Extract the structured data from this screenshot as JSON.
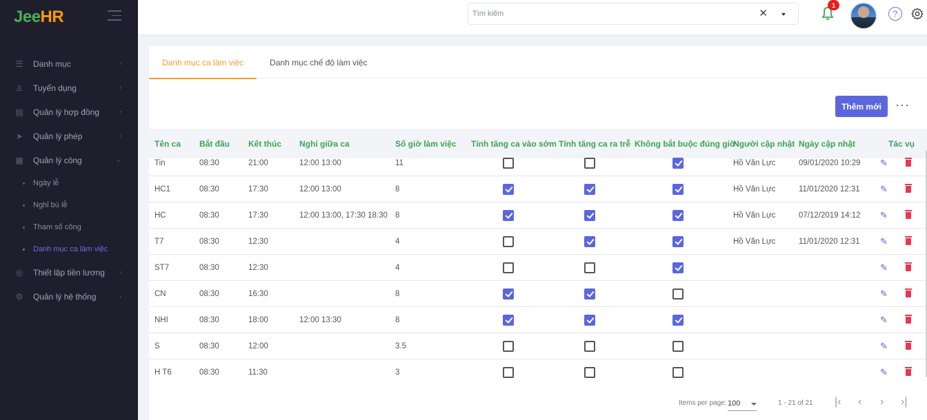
{
  "brand": {
    "part1": "Jee",
    "part2": "HR"
  },
  "sidebar": {
    "items": [
      {
        "label": "Danh mục",
        "icon": "list-icon"
      },
      {
        "label": "Tuyển dụng",
        "icon": "person-icon"
      },
      {
        "label": "Quản lý hợp đồng",
        "icon": "briefcase-icon"
      },
      {
        "label": "Quản lý phép",
        "icon": "send-icon"
      },
      {
        "label": "Quản lý công",
        "icon": "calendar-icon"
      }
    ],
    "sub_items": [
      {
        "label": "Ngày lễ",
        "active": false
      },
      {
        "label": "Nghỉ bù lễ",
        "active": false
      },
      {
        "label": "Tham số công",
        "active": false
      },
      {
        "label": "Danh mục ca làm việc",
        "active": true
      }
    ],
    "items_after": [
      {
        "label": "Thiết lập tiền lương",
        "icon": "settings-icon"
      },
      {
        "label": "Quản lý hệ thống",
        "icon": "cog-icon"
      }
    ]
  },
  "header": {
    "search_placeholder": "Tìm kiếm",
    "notification_count": "1"
  },
  "tabs": [
    {
      "label": "Danh mục ca làm việc",
      "active": true
    },
    {
      "label": "Danh mục chế độ làm việc",
      "active": false
    }
  ],
  "toolbar": {
    "add_label": "Thêm mới",
    "more_label": "···"
  },
  "table": {
    "headers": [
      "Tên ca",
      "Bắt đầu",
      "Kết thúc",
      "Nghỉ giữa ca",
      "Số giờ làm việc",
      "Tính tăng ca vào sớm",
      "Tính tăng ca ra trễ",
      "Không bắt buộc đúng giờ",
      "Người cập nhật",
      "Ngày cập nhật",
      "Tác vụ"
    ],
    "rows": [
      {
        "name": "Tin",
        "start": "08:30",
        "end": "21:00",
        "break": "12:00 13:00",
        "hours": "11",
        "early": false,
        "late": false,
        "flex": true,
        "updater": "Hồ Văn Lực",
        "updated": "09/01/2020 10:29"
      },
      {
        "name": "HC1",
        "start": "08:30",
        "end": "17:30",
        "break": "12:00 13:00",
        "hours": "8",
        "early": true,
        "late": true,
        "flex": true,
        "updater": "Hồ Văn Lực",
        "updated": "11/01/2020 12:31"
      },
      {
        "name": "HC",
        "start": "08:30",
        "end": "17:30",
        "break": "12:00 13:00, 17:30 18:30",
        "hours": "8",
        "early": true,
        "late": true,
        "flex": true,
        "updater": "Hồ Văn Lực",
        "updated": "07/12/2019 14:12"
      },
      {
        "name": "T7",
        "start": "08:30",
        "end": "12:30",
        "break": "",
        "hours": "4",
        "early": false,
        "late": true,
        "flex": true,
        "updater": "Hồ Văn Lực",
        "updated": "11/01/2020 12:31"
      },
      {
        "name": "ST7",
        "start": "08:30",
        "end": "12:30",
        "break": "",
        "hours": "4",
        "early": false,
        "late": false,
        "flex": true,
        "updater": "",
        "updated": ""
      },
      {
        "name": "CN",
        "start": "08:30",
        "end": "16:30",
        "break": "",
        "hours": "8",
        "early": true,
        "late": true,
        "flex": false,
        "updater": "",
        "updated": ""
      },
      {
        "name": "NHI",
        "start": "08:30",
        "end": "18:00",
        "break": "12:00 13:30",
        "hours": "8",
        "early": true,
        "late": true,
        "flex": true,
        "updater": "",
        "updated": ""
      },
      {
        "name": "S",
        "start": "08:30",
        "end": "12:00",
        "break": "",
        "hours": "3.5",
        "early": false,
        "late": false,
        "flex": false,
        "updater": "",
        "updated": ""
      },
      {
        "name": "H T6",
        "start": "08:30",
        "end": "11:30",
        "break": "",
        "hours": "3",
        "early": false,
        "late": false,
        "flex": false,
        "updater": "",
        "updated": ""
      }
    ]
  },
  "paginator": {
    "items_per_page_label": "Items per page:",
    "page_size": "100",
    "range": "1 - 21 of 21"
  },
  "colors": {
    "accent": "#5b66dd",
    "tab_active": "#f59c2a",
    "header_text": "#3aa555",
    "delete": "#e63950",
    "sidebar_bg": "#1e1e2d"
  }
}
